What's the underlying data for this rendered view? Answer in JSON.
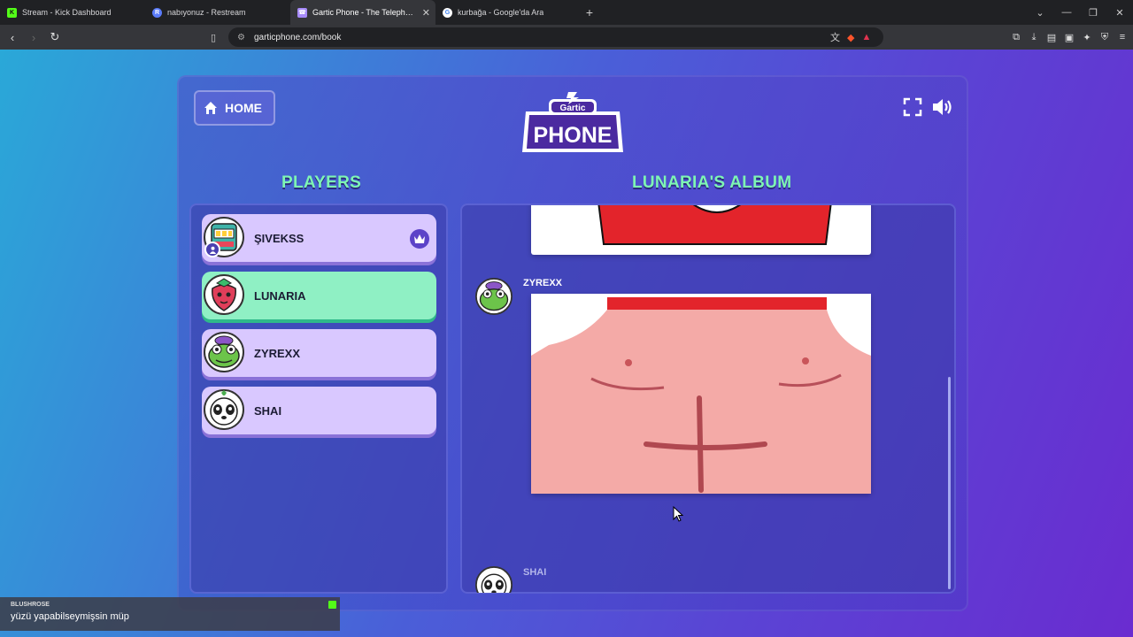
{
  "browser": {
    "tabs": [
      {
        "label": "Stream - Kick Dashboard",
        "fav_color": "#53fc18",
        "fav_glyph": "K",
        "active": false
      },
      {
        "label": "nabıyonuz - Restream",
        "fav_color": "#5b7cfa",
        "fav_glyph": "R",
        "active": false
      },
      {
        "label": "Gartic Phone - The Telephone G",
        "fav_color": "#a78bfa",
        "fav_glyph": "☎",
        "active": true
      },
      {
        "label": "kurbağa - Google'da Ara",
        "fav_color": "#ffffff",
        "fav_glyph": "G",
        "active": false
      }
    ],
    "url": "garticphone.com/book"
  },
  "game": {
    "home_label": "HOME",
    "logo_top": "Gartic",
    "logo_bottom": "PHONE",
    "players_title": "PLAYERS",
    "album_title": "LUNARIA'S ALBUM",
    "players": [
      {
        "name": "ŞIVEKSS",
        "active": false,
        "host": true,
        "avatar": "slot-machine-avatar"
      },
      {
        "name": "LUNARIA",
        "active": true,
        "host": false,
        "avatar": "strawberry-avatar"
      },
      {
        "name": "ZYREXX",
        "active": false,
        "host": false,
        "avatar": "frog-avatar"
      },
      {
        "name": "SHAI",
        "active": false,
        "host": false,
        "avatar": "panda-avatar"
      }
    ],
    "album_entries": [
      {
        "author": "ZYREXX"
      },
      {
        "author": "SHAI"
      }
    ]
  },
  "chat_overlay": {
    "username": "BLUSHROSE",
    "message": "yüzü yapabilseymişsin müp"
  },
  "colors": {
    "accent_green": "#7ef5b4",
    "player_card": "#d9c8ff",
    "player_active": "#8ff0c4"
  }
}
